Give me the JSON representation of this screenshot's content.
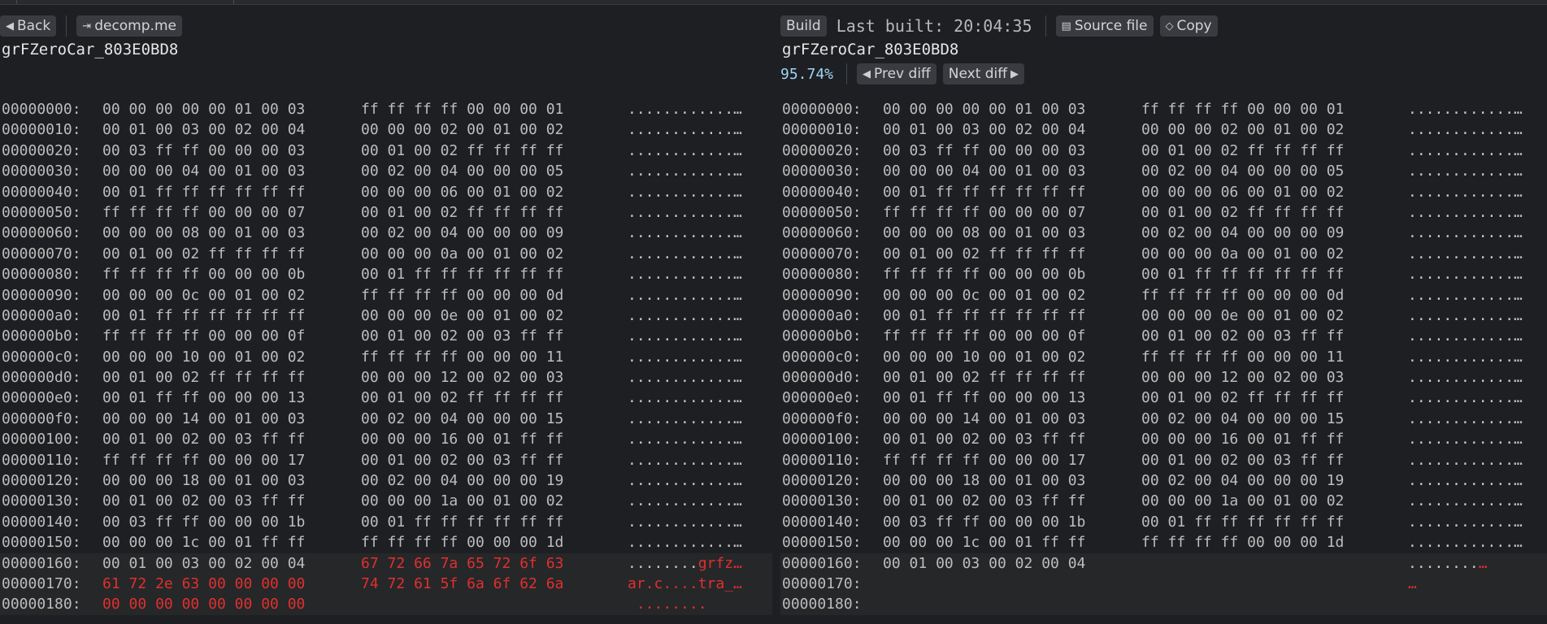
{
  "left": {
    "toolbar": {
      "back_label": "Back",
      "decomp_label": "decomp.me"
    },
    "function_name": "grFZeroCar_803E0BD8",
    "rows": [
      {
        "addr": "00000000:",
        "g1": [
          "00",
          "00",
          "00",
          "00",
          "00",
          "01",
          "00",
          "03"
        ],
        "g2": [
          "ff",
          "ff",
          "ff",
          "ff",
          "00",
          "00",
          "00",
          "01"
        ],
        "ascii": "............"
      },
      {
        "addr": "00000010:",
        "g1": [
          "00",
          "01",
          "00",
          "03",
          "00",
          "02",
          "00",
          "04"
        ],
        "g2": [
          "00",
          "00",
          "00",
          "02",
          "00",
          "01",
          "00",
          "02"
        ],
        "ascii": "............"
      },
      {
        "addr": "00000020:",
        "g1": [
          "00",
          "03",
          "ff",
          "ff",
          "00",
          "00",
          "00",
          "03"
        ],
        "g2": [
          "00",
          "01",
          "00",
          "02",
          "ff",
          "ff",
          "ff",
          "ff"
        ],
        "ascii": "............"
      },
      {
        "addr": "00000030:",
        "g1": [
          "00",
          "00",
          "00",
          "04",
          "00",
          "01",
          "00",
          "03"
        ],
        "g2": [
          "00",
          "02",
          "00",
          "04",
          "00",
          "00",
          "00",
          "05"
        ],
        "ascii": "............"
      },
      {
        "addr": "00000040:",
        "g1": [
          "00",
          "01",
          "ff",
          "ff",
          "ff",
          "ff",
          "ff",
          "ff"
        ],
        "g2": [
          "00",
          "00",
          "00",
          "06",
          "00",
          "01",
          "00",
          "02"
        ],
        "ascii": "............"
      },
      {
        "addr": "00000050:",
        "g1": [
          "ff",
          "ff",
          "ff",
          "ff",
          "00",
          "00",
          "00",
          "07"
        ],
        "g2": [
          "00",
          "01",
          "00",
          "02",
          "ff",
          "ff",
          "ff",
          "ff"
        ],
        "ascii": "............"
      },
      {
        "addr": "00000060:",
        "g1": [
          "00",
          "00",
          "00",
          "08",
          "00",
          "01",
          "00",
          "03"
        ],
        "g2": [
          "00",
          "02",
          "00",
          "04",
          "00",
          "00",
          "00",
          "09"
        ],
        "ascii": "............"
      },
      {
        "addr": "00000070:",
        "g1": [
          "00",
          "01",
          "00",
          "02",
          "ff",
          "ff",
          "ff",
          "ff"
        ],
        "g2": [
          "00",
          "00",
          "00",
          "0a",
          "00",
          "01",
          "00",
          "02"
        ],
        "ascii": "............"
      },
      {
        "addr": "00000080:",
        "g1": [
          "ff",
          "ff",
          "ff",
          "ff",
          "00",
          "00",
          "00",
          "0b"
        ],
        "g2": [
          "00",
          "01",
          "ff",
          "ff",
          "ff",
          "ff",
          "ff",
          "ff"
        ],
        "ascii": "............"
      },
      {
        "addr": "00000090:",
        "g1": [
          "00",
          "00",
          "00",
          "0c",
          "00",
          "01",
          "00",
          "02"
        ],
        "g2": [
          "ff",
          "ff",
          "ff",
          "ff",
          "00",
          "00",
          "00",
          "0d"
        ],
        "ascii": "............"
      },
      {
        "addr": "000000a0:",
        "g1": [
          "00",
          "01",
          "ff",
          "ff",
          "ff",
          "ff",
          "ff",
          "ff"
        ],
        "g2": [
          "00",
          "00",
          "00",
          "0e",
          "00",
          "01",
          "00",
          "02"
        ],
        "ascii": "............"
      },
      {
        "addr": "000000b0:",
        "g1": [
          "ff",
          "ff",
          "ff",
          "ff",
          "00",
          "00",
          "00",
          "0f"
        ],
        "g2": [
          "00",
          "01",
          "00",
          "02",
          "00",
          "03",
          "ff",
          "ff"
        ],
        "ascii": "............"
      },
      {
        "addr": "000000c0:",
        "g1": [
          "00",
          "00",
          "00",
          "10",
          "00",
          "01",
          "00",
          "02"
        ],
        "g2": [
          "ff",
          "ff",
          "ff",
          "ff",
          "00",
          "00",
          "00",
          "11"
        ],
        "ascii": "............"
      },
      {
        "addr": "000000d0:",
        "g1": [
          "00",
          "01",
          "00",
          "02",
          "ff",
          "ff",
          "ff",
          "ff"
        ],
        "g2": [
          "00",
          "00",
          "00",
          "12",
          "00",
          "02",
          "00",
          "03"
        ],
        "ascii": "............"
      },
      {
        "addr": "000000e0:",
        "g1": [
          "00",
          "01",
          "ff",
          "ff",
          "00",
          "00",
          "00",
          "13"
        ],
        "g2": [
          "00",
          "01",
          "00",
          "02",
          "ff",
          "ff",
          "ff",
          "ff"
        ],
        "ascii": "............"
      },
      {
        "addr": "000000f0:",
        "g1": [
          "00",
          "00",
          "00",
          "14",
          "00",
          "01",
          "00",
          "03"
        ],
        "g2": [
          "00",
          "02",
          "00",
          "04",
          "00",
          "00",
          "00",
          "15"
        ],
        "ascii": "............"
      },
      {
        "addr": "00000100:",
        "g1": [
          "00",
          "01",
          "00",
          "02",
          "00",
          "03",
          "ff",
          "ff"
        ],
        "g2": [
          "00",
          "00",
          "00",
          "16",
          "00",
          "01",
          "ff",
          "ff"
        ],
        "ascii": "............"
      },
      {
        "addr": "00000110:",
        "g1": [
          "ff",
          "ff",
          "ff",
          "ff",
          "00",
          "00",
          "00",
          "17"
        ],
        "g2": [
          "00",
          "01",
          "00",
          "02",
          "00",
          "03",
          "ff",
          "ff"
        ],
        "ascii": "............"
      },
      {
        "addr": "00000120:",
        "g1": [
          "00",
          "00",
          "00",
          "18",
          "00",
          "01",
          "00",
          "03"
        ],
        "g2": [
          "00",
          "02",
          "00",
          "04",
          "00",
          "00",
          "00",
          "19"
        ],
        "ascii": "............"
      },
      {
        "addr": "00000130:",
        "g1": [
          "00",
          "01",
          "00",
          "02",
          "00",
          "03",
          "ff",
          "ff"
        ],
        "g2": [
          "00",
          "00",
          "00",
          "1a",
          "00",
          "01",
          "00",
          "02"
        ],
        "ascii": "............"
      },
      {
        "addr": "00000140:",
        "g1": [
          "00",
          "03",
          "ff",
          "ff",
          "00",
          "00",
          "00",
          "1b"
        ],
        "g2": [
          "00",
          "01",
          "ff",
          "ff",
          "ff",
          "ff",
          "ff",
          "ff"
        ],
        "ascii": "............"
      },
      {
        "addr": "00000150:",
        "g1": [
          "00",
          "00",
          "00",
          "1c",
          "00",
          "01",
          "ff",
          "ff"
        ],
        "g2": [
          "ff",
          "ff",
          "ff",
          "ff",
          "00",
          "00",
          "00",
          "1d"
        ],
        "ascii": "............"
      },
      {
        "addr": "00000160:",
        "g1": [
          "00",
          "01",
          "00",
          "03",
          "00",
          "02",
          "00",
          "04"
        ],
        "g2": [
          "67",
          "72",
          "66",
          "7a",
          "65",
          "72",
          "6f",
          "63"
        ],
        "g2red": true,
        "diff": true,
        "ascii": "........",
        "ascii_red": "grfz"
      },
      {
        "addr": "00000170:",
        "g1": [
          "61",
          "72",
          "2e",
          "63",
          "00",
          "00",
          "00",
          "00"
        ],
        "g1red": true,
        "g2": [
          "74",
          "72",
          "61",
          "5f",
          "6a",
          "6f",
          "62",
          "6a"
        ],
        "g2red": true,
        "diff": true,
        "ascii": "",
        "ascii_red": "ar.c....tra_"
      },
      {
        "addr": "00000180:",
        "g1": [
          "00",
          "00",
          "00",
          "00",
          "00",
          "00",
          "00",
          "00"
        ],
        "g1red": true,
        "g2": [],
        "diff": true,
        "ascii": "",
        "ascii_red": " ........",
        "noell": true
      }
    ]
  },
  "right": {
    "toolbar": {
      "build_label": "Build",
      "last_built": "Last built: 20:04:35",
      "source_label": "Source file",
      "copy_label": "Copy",
      "prev_label": "Prev diff",
      "next_label": "Next diff"
    },
    "function_name": "grFZeroCar_803E0BD8",
    "match_percent": "95.74%",
    "rows": [
      {
        "addr": "00000000:",
        "g1": [
          "00",
          "00",
          "00",
          "00",
          "00",
          "01",
          "00",
          "03"
        ],
        "g2": [
          "ff",
          "ff",
          "ff",
          "ff",
          "00",
          "00",
          "00",
          "01"
        ],
        "ascii": "............"
      },
      {
        "addr": "00000010:",
        "g1": [
          "00",
          "01",
          "00",
          "03",
          "00",
          "02",
          "00",
          "04"
        ],
        "g2": [
          "00",
          "00",
          "00",
          "02",
          "00",
          "01",
          "00",
          "02"
        ],
        "ascii": "............"
      },
      {
        "addr": "00000020:",
        "g1": [
          "00",
          "03",
          "ff",
          "ff",
          "00",
          "00",
          "00",
          "03"
        ],
        "g2": [
          "00",
          "01",
          "00",
          "02",
          "ff",
          "ff",
          "ff",
          "ff"
        ],
        "ascii": "............"
      },
      {
        "addr": "00000030:",
        "g1": [
          "00",
          "00",
          "00",
          "04",
          "00",
          "01",
          "00",
          "03"
        ],
        "g2": [
          "00",
          "02",
          "00",
          "04",
          "00",
          "00",
          "00",
          "05"
        ],
        "ascii": "............"
      },
      {
        "addr": "00000040:",
        "g1": [
          "00",
          "01",
          "ff",
          "ff",
          "ff",
          "ff",
          "ff",
          "ff"
        ],
        "g2": [
          "00",
          "00",
          "00",
          "06",
          "00",
          "01",
          "00",
          "02"
        ],
        "ascii": "............"
      },
      {
        "addr": "00000050:",
        "g1": [
          "ff",
          "ff",
          "ff",
          "ff",
          "00",
          "00",
          "00",
          "07"
        ],
        "g2": [
          "00",
          "01",
          "00",
          "02",
          "ff",
          "ff",
          "ff",
          "ff"
        ],
        "ascii": "............"
      },
      {
        "addr": "00000060:",
        "g1": [
          "00",
          "00",
          "00",
          "08",
          "00",
          "01",
          "00",
          "03"
        ],
        "g2": [
          "00",
          "02",
          "00",
          "04",
          "00",
          "00",
          "00",
          "09"
        ],
        "ascii": "............"
      },
      {
        "addr": "00000070:",
        "g1": [
          "00",
          "01",
          "00",
          "02",
          "ff",
          "ff",
          "ff",
          "ff"
        ],
        "g2": [
          "00",
          "00",
          "00",
          "0a",
          "00",
          "01",
          "00",
          "02"
        ],
        "ascii": "............"
      },
      {
        "addr": "00000080:",
        "g1": [
          "ff",
          "ff",
          "ff",
          "ff",
          "00",
          "00",
          "00",
          "0b"
        ],
        "g2": [
          "00",
          "01",
          "ff",
          "ff",
          "ff",
          "ff",
          "ff",
          "ff"
        ],
        "ascii": "............"
      },
      {
        "addr": "00000090:",
        "g1": [
          "00",
          "00",
          "00",
          "0c",
          "00",
          "01",
          "00",
          "02"
        ],
        "g2": [
          "ff",
          "ff",
          "ff",
          "ff",
          "00",
          "00",
          "00",
          "0d"
        ],
        "ascii": "............"
      },
      {
        "addr": "000000a0:",
        "g1": [
          "00",
          "01",
          "ff",
          "ff",
          "ff",
          "ff",
          "ff",
          "ff"
        ],
        "g2": [
          "00",
          "00",
          "00",
          "0e",
          "00",
          "01",
          "00",
          "02"
        ],
        "ascii": "............"
      },
      {
        "addr": "000000b0:",
        "g1": [
          "ff",
          "ff",
          "ff",
          "ff",
          "00",
          "00",
          "00",
          "0f"
        ],
        "g2": [
          "00",
          "01",
          "00",
          "02",
          "00",
          "03",
          "ff",
          "ff"
        ],
        "ascii": "............"
      },
      {
        "addr": "000000c0:",
        "g1": [
          "00",
          "00",
          "00",
          "10",
          "00",
          "01",
          "00",
          "02"
        ],
        "g2": [
          "ff",
          "ff",
          "ff",
          "ff",
          "00",
          "00",
          "00",
          "11"
        ],
        "ascii": "............"
      },
      {
        "addr": "000000d0:",
        "g1": [
          "00",
          "01",
          "00",
          "02",
          "ff",
          "ff",
          "ff",
          "ff"
        ],
        "g2": [
          "00",
          "00",
          "00",
          "12",
          "00",
          "02",
          "00",
          "03"
        ],
        "ascii": "............"
      },
      {
        "addr": "000000e0:",
        "g1": [
          "00",
          "01",
          "ff",
          "ff",
          "00",
          "00",
          "00",
          "13"
        ],
        "g2": [
          "00",
          "01",
          "00",
          "02",
          "ff",
          "ff",
          "ff",
          "ff"
        ],
        "ascii": "............"
      },
      {
        "addr": "000000f0:",
        "g1": [
          "00",
          "00",
          "00",
          "14",
          "00",
          "01",
          "00",
          "03"
        ],
        "g2": [
          "00",
          "02",
          "00",
          "04",
          "00",
          "00",
          "00",
          "15"
        ],
        "ascii": "............"
      },
      {
        "addr": "00000100:",
        "g1": [
          "00",
          "01",
          "00",
          "02",
          "00",
          "03",
          "ff",
          "ff"
        ],
        "g2": [
          "00",
          "00",
          "00",
          "16",
          "00",
          "01",
          "ff",
          "ff"
        ],
        "ascii": "............"
      },
      {
        "addr": "00000110:",
        "g1": [
          "ff",
          "ff",
          "ff",
          "ff",
          "00",
          "00",
          "00",
          "17"
        ],
        "g2": [
          "00",
          "01",
          "00",
          "02",
          "00",
          "03",
          "ff",
          "ff"
        ],
        "ascii": "............"
      },
      {
        "addr": "00000120:",
        "g1": [
          "00",
          "00",
          "00",
          "18",
          "00",
          "01",
          "00",
          "03"
        ],
        "g2": [
          "00",
          "02",
          "00",
          "04",
          "00",
          "00",
          "00",
          "19"
        ],
        "ascii": "............"
      },
      {
        "addr": "00000130:",
        "g1": [
          "00",
          "01",
          "00",
          "02",
          "00",
          "03",
          "ff",
          "ff"
        ],
        "g2": [
          "00",
          "00",
          "00",
          "1a",
          "00",
          "01",
          "00",
          "02"
        ],
        "ascii": "............"
      },
      {
        "addr": "00000140:",
        "g1": [
          "00",
          "03",
          "ff",
          "ff",
          "00",
          "00",
          "00",
          "1b"
        ],
        "g2": [
          "00",
          "01",
          "ff",
          "ff",
          "ff",
          "ff",
          "ff",
          "ff"
        ],
        "ascii": "............"
      },
      {
        "addr": "00000150:",
        "g1": [
          "00",
          "00",
          "00",
          "1c",
          "00",
          "01",
          "ff",
          "ff"
        ],
        "g2": [
          "ff",
          "ff",
          "ff",
          "ff",
          "00",
          "00",
          "00",
          "1d"
        ],
        "ascii": "............"
      },
      {
        "addr": "00000160:",
        "g1": [
          "00",
          "01",
          "00",
          "03",
          "00",
          "02",
          "00",
          "04"
        ],
        "g2": [],
        "diff": true,
        "ascii": "........",
        "ellred": true
      },
      {
        "addr": "00000170:",
        "g1": [],
        "g2": [],
        "diff": true,
        "ascii": "",
        "ellred": true
      },
      {
        "addr": "00000180:",
        "g1": [],
        "g2": [],
        "diff": true,
        "ascii": "",
        "noell": true
      }
    ]
  },
  "icons": {
    "back": "caret-left-icon",
    "decomp": "external-link-icon",
    "source": "file-icon",
    "copy": "tag-icon",
    "prev": "caret-left-icon",
    "next": "caret-right-icon"
  },
  "colors": {
    "diff_red": "#e0302f",
    "percent_blue": "#9fd4f5"
  }
}
